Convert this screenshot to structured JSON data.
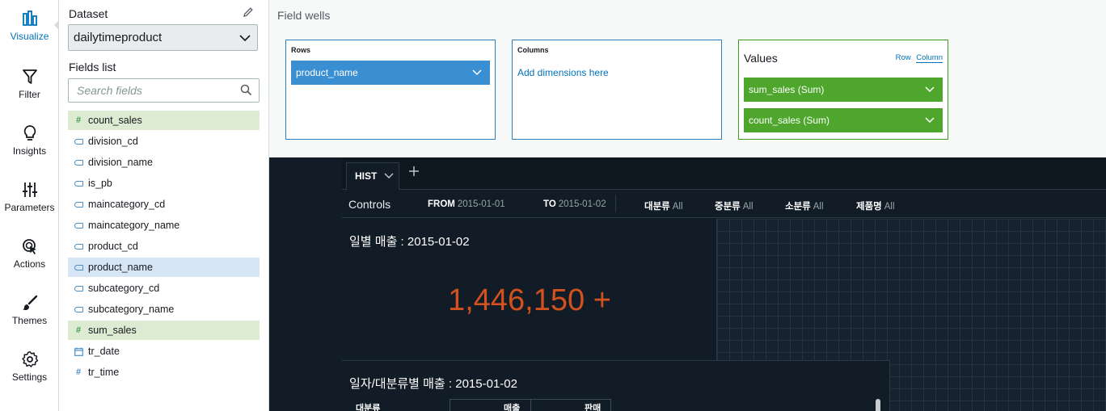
{
  "rail": {
    "items": [
      {
        "label": "Visualize",
        "icon": "bar-chart-icon",
        "active": true
      },
      {
        "label": "Filter",
        "icon": "funnel-icon"
      },
      {
        "label": "Insights",
        "icon": "lightbulb-icon"
      },
      {
        "label": "Parameters",
        "icon": "sliders-icon"
      },
      {
        "label": "Actions",
        "icon": "cursor-click-icon"
      },
      {
        "label": "Themes",
        "icon": "brush-icon"
      },
      {
        "label": "Settings",
        "icon": "gear-icon"
      }
    ]
  },
  "panel": {
    "dataset_label": "Dataset",
    "dataset_value": "dailytimeproduct",
    "fields_label": "Fields list",
    "search_placeholder": "Search fields",
    "fields": [
      {
        "name": "count_sales",
        "type": "measure",
        "selected": true
      },
      {
        "name": "division_cd",
        "type": "dimension"
      },
      {
        "name": "division_name",
        "type": "dimension"
      },
      {
        "name": "is_pb",
        "type": "dimension"
      },
      {
        "name": "maincategory_cd",
        "type": "dimension"
      },
      {
        "name": "maincategory_name",
        "type": "dimension"
      },
      {
        "name": "product_cd",
        "type": "dimension"
      },
      {
        "name": "product_name",
        "type": "dimension",
        "selected": true
      },
      {
        "name": "subcategory_cd",
        "type": "dimension"
      },
      {
        "name": "subcategory_name",
        "type": "dimension"
      },
      {
        "name": "sum_sales",
        "type": "measure",
        "selected": true
      },
      {
        "name": "tr_date",
        "type": "date"
      },
      {
        "name": "tr_time",
        "type": "measure"
      }
    ]
  },
  "wells": {
    "title": "Field wells",
    "rows_label": "Rows",
    "rows_field": "product_name",
    "columns_label": "Columns",
    "columns_placeholder": "Add dimensions here",
    "values_label": "Values",
    "row_toggle": "Row",
    "column_toggle": "Column",
    "values_fields": [
      "sum_sales (Sum)",
      "count_sales (Sum)"
    ]
  },
  "dashboard": {
    "tab_label": "HIST",
    "controls_title": "Controls",
    "controls": [
      {
        "label": "FROM",
        "value": "2015-01-01"
      },
      {
        "label": "TO",
        "value": "2015-01-02"
      },
      {
        "label": "대분류",
        "value": "All"
      },
      {
        "label": "중분류",
        "value": "All"
      },
      {
        "label": "소분류",
        "value": "All"
      },
      {
        "label": "제품명",
        "value": "All"
      }
    ],
    "kpi_title": "일별 매출 : 2015-01-02",
    "kpi_value": "1,446,150",
    "kpi_trend": "+",
    "table_title": "일자/대분류별 매출 : 2015-01-02",
    "table_headers": [
      "대분류",
      "매출",
      "판매"
    ]
  },
  "colors": {
    "accent_blue": "#0073bb",
    "well_blue": "#3a8fd2",
    "well_green": "#4ea62d",
    "kpi_orange": "#d3501f",
    "dashboard_bg": "#121c26"
  }
}
